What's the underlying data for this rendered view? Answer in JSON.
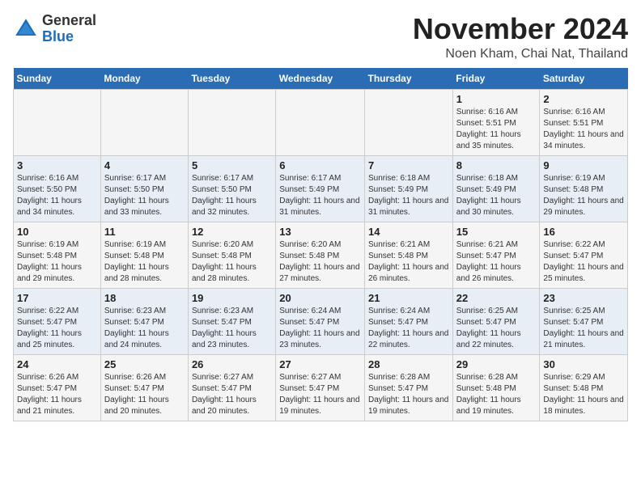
{
  "logo": {
    "general": "General",
    "blue": "Blue"
  },
  "header": {
    "month_title": "November 2024",
    "location": "Noen Kham, Chai Nat, Thailand"
  },
  "calendar": {
    "days_of_week": [
      "Sunday",
      "Monday",
      "Tuesday",
      "Wednesday",
      "Thursday",
      "Friday",
      "Saturday"
    ],
    "weeks": [
      [
        {
          "day": "",
          "info": ""
        },
        {
          "day": "",
          "info": ""
        },
        {
          "day": "",
          "info": ""
        },
        {
          "day": "",
          "info": ""
        },
        {
          "day": "",
          "info": ""
        },
        {
          "day": "1",
          "info": "Sunrise: 6:16 AM\nSunset: 5:51 PM\nDaylight: 11 hours and 35 minutes."
        },
        {
          "day": "2",
          "info": "Sunrise: 6:16 AM\nSunset: 5:51 PM\nDaylight: 11 hours and 34 minutes."
        }
      ],
      [
        {
          "day": "3",
          "info": "Sunrise: 6:16 AM\nSunset: 5:50 PM\nDaylight: 11 hours and 34 minutes."
        },
        {
          "day": "4",
          "info": "Sunrise: 6:17 AM\nSunset: 5:50 PM\nDaylight: 11 hours and 33 minutes."
        },
        {
          "day": "5",
          "info": "Sunrise: 6:17 AM\nSunset: 5:50 PM\nDaylight: 11 hours and 32 minutes."
        },
        {
          "day": "6",
          "info": "Sunrise: 6:17 AM\nSunset: 5:49 PM\nDaylight: 11 hours and 31 minutes."
        },
        {
          "day": "7",
          "info": "Sunrise: 6:18 AM\nSunset: 5:49 PM\nDaylight: 11 hours and 31 minutes."
        },
        {
          "day": "8",
          "info": "Sunrise: 6:18 AM\nSunset: 5:49 PM\nDaylight: 11 hours and 30 minutes."
        },
        {
          "day": "9",
          "info": "Sunrise: 6:19 AM\nSunset: 5:48 PM\nDaylight: 11 hours and 29 minutes."
        }
      ],
      [
        {
          "day": "10",
          "info": "Sunrise: 6:19 AM\nSunset: 5:48 PM\nDaylight: 11 hours and 29 minutes."
        },
        {
          "day": "11",
          "info": "Sunrise: 6:19 AM\nSunset: 5:48 PM\nDaylight: 11 hours and 28 minutes."
        },
        {
          "day": "12",
          "info": "Sunrise: 6:20 AM\nSunset: 5:48 PM\nDaylight: 11 hours and 28 minutes."
        },
        {
          "day": "13",
          "info": "Sunrise: 6:20 AM\nSunset: 5:48 PM\nDaylight: 11 hours and 27 minutes."
        },
        {
          "day": "14",
          "info": "Sunrise: 6:21 AM\nSunset: 5:48 PM\nDaylight: 11 hours and 26 minutes."
        },
        {
          "day": "15",
          "info": "Sunrise: 6:21 AM\nSunset: 5:47 PM\nDaylight: 11 hours and 26 minutes."
        },
        {
          "day": "16",
          "info": "Sunrise: 6:22 AM\nSunset: 5:47 PM\nDaylight: 11 hours and 25 minutes."
        }
      ],
      [
        {
          "day": "17",
          "info": "Sunrise: 6:22 AM\nSunset: 5:47 PM\nDaylight: 11 hours and 25 minutes."
        },
        {
          "day": "18",
          "info": "Sunrise: 6:23 AM\nSunset: 5:47 PM\nDaylight: 11 hours and 24 minutes."
        },
        {
          "day": "19",
          "info": "Sunrise: 6:23 AM\nSunset: 5:47 PM\nDaylight: 11 hours and 23 minutes."
        },
        {
          "day": "20",
          "info": "Sunrise: 6:24 AM\nSunset: 5:47 PM\nDaylight: 11 hours and 23 minutes."
        },
        {
          "day": "21",
          "info": "Sunrise: 6:24 AM\nSunset: 5:47 PM\nDaylight: 11 hours and 22 minutes."
        },
        {
          "day": "22",
          "info": "Sunrise: 6:25 AM\nSunset: 5:47 PM\nDaylight: 11 hours and 22 minutes."
        },
        {
          "day": "23",
          "info": "Sunrise: 6:25 AM\nSunset: 5:47 PM\nDaylight: 11 hours and 21 minutes."
        }
      ],
      [
        {
          "day": "24",
          "info": "Sunrise: 6:26 AM\nSunset: 5:47 PM\nDaylight: 11 hours and 21 minutes."
        },
        {
          "day": "25",
          "info": "Sunrise: 6:26 AM\nSunset: 5:47 PM\nDaylight: 11 hours and 20 minutes."
        },
        {
          "day": "26",
          "info": "Sunrise: 6:27 AM\nSunset: 5:47 PM\nDaylight: 11 hours and 20 minutes."
        },
        {
          "day": "27",
          "info": "Sunrise: 6:27 AM\nSunset: 5:47 PM\nDaylight: 11 hours and 19 minutes."
        },
        {
          "day": "28",
          "info": "Sunrise: 6:28 AM\nSunset: 5:47 PM\nDaylight: 11 hours and 19 minutes."
        },
        {
          "day": "29",
          "info": "Sunrise: 6:28 AM\nSunset: 5:48 PM\nDaylight: 11 hours and 19 minutes."
        },
        {
          "day": "30",
          "info": "Sunrise: 6:29 AM\nSunset: 5:48 PM\nDaylight: 11 hours and 18 minutes."
        }
      ]
    ]
  }
}
